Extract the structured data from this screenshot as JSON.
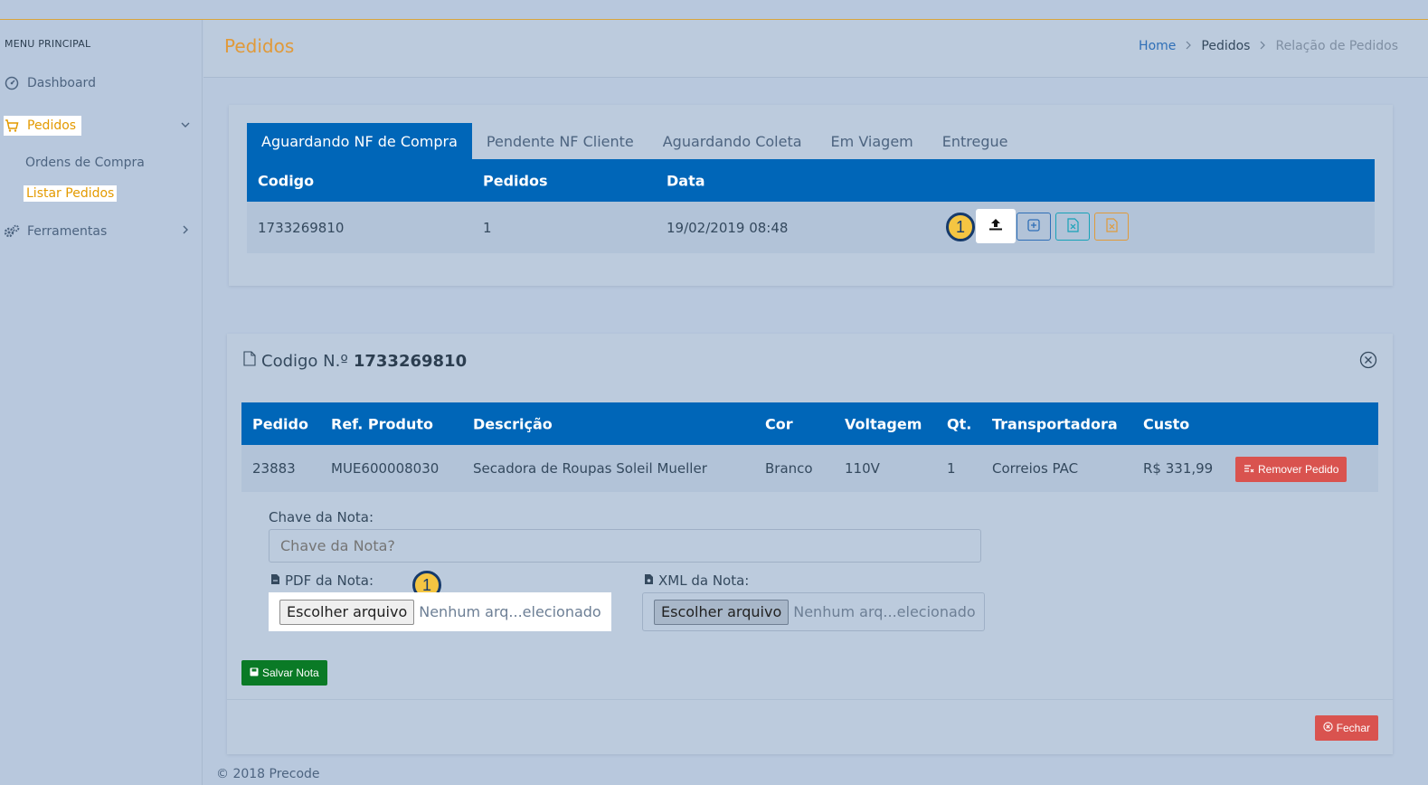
{
  "colors": {
    "accent": "#0066b8",
    "active_menu": "#e39a00",
    "danger": "#d9534f",
    "success": "#0a7a26",
    "badge": "#f4c542"
  },
  "sidebar": {
    "heading": "MENU PRINCIPAL",
    "items": [
      {
        "label": "Dashboard",
        "icon": "dashboard-icon"
      },
      {
        "label": "Pedidos",
        "icon": "cart-icon",
        "active": true
      },
      {
        "label": "Ferramentas",
        "icon": "gears-icon"
      }
    ],
    "pedidos_sub": [
      {
        "label": "Ordens de Compra"
      },
      {
        "label": "Listar Pedidos",
        "active": true
      }
    ]
  },
  "header": {
    "title": "Pedidos",
    "breadcrumb": [
      "Home",
      "Pedidos",
      "Relação de Pedidos"
    ]
  },
  "orders": {
    "tabs": [
      "Aguardando NF de Compra",
      "Pendente NF Cliente",
      "Aguardando Coleta",
      "Em Viagem",
      "Entregue"
    ],
    "active_tab": "Aguardando NF de Compra",
    "columns": [
      "Codigo",
      "Pedidos",
      "Data"
    ],
    "rows": [
      {
        "codigo": "1733269810",
        "pedidos": "1",
        "data": "19/02/2019 08:48"
      }
    ],
    "actions": [
      "upload-icon",
      "plus-square-icon",
      "excel-icon",
      "excel-icon"
    ],
    "badge": "1"
  },
  "detail": {
    "title_prefix": "Codigo N.º",
    "code": "1733269810",
    "columns": [
      "Pedido",
      "Ref. Produto",
      "Descrição",
      "Cor",
      "Voltagem",
      "Qt.",
      "Transportadora",
      "Custo"
    ],
    "rows": [
      {
        "pedido": "23883",
        "ref": "MUE600008030",
        "descricao": "Secadora de Roupas Soleil Mueller",
        "cor": "Branco",
        "voltagem": "110V",
        "qt": "1",
        "transportadora": "Correios PAC",
        "custo": "R$ 331,99"
      }
    ],
    "remove_label": "Remover Pedido",
    "chave_label": "Chave da Nota:",
    "chave_placeholder": "Chave da Nota?",
    "pdf_label": "PDF da Nota:",
    "xml_label": "XML da Nota:",
    "file_button": "Escolher arquivo",
    "file_none": "Nenhum arq...elecionado",
    "badge": "1",
    "save_label": "Salvar Nota",
    "close_label": "Fechar"
  },
  "footer": "© 2018 Precode"
}
